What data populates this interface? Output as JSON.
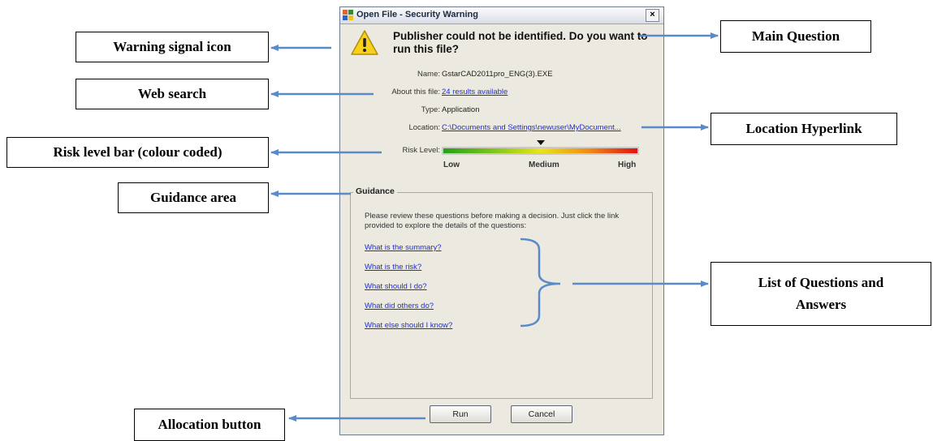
{
  "annotations": {
    "warning_icon": "Warning signal icon",
    "web_search": "Web search",
    "risk_bar": "Risk level bar (colour coded)",
    "guidance_area": "Guidance area",
    "allocation_button": "Allocation button",
    "main_question": "Main Question",
    "location_hyperlink": "Location Hyperlink",
    "qa_list_line1": "List of Questions and",
    "qa_list_line2": "Answers"
  },
  "dialog": {
    "title": "Open File - Security Warning",
    "close_glyph": "×",
    "question": "Publisher could not be identified. Do you want to run this file?",
    "fields": {
      "name_label": "Name:",
      "name_value": "GstarCAD2011pro_ENG(3).EXE",
      "about_label": "About this file:",
      "about_value": "24 results available",
      "type_label": "Type:",
      "type_value": "Application",
      "location_label": "Location:",
      "location_value": "C:\\Documents and Settings\\newuser\\MyDocument..."
    },
    "risk": {
      "label": "Risk Level:",
      "low": "Low",
      "medium": "Medium",
      "high": "High",
      "level_fraction": 0.5,
      "colors": [
        "#22a11b",
        "#e8e517",
        "#de1414"
      ]
    },
    "guidance": {
      "legend": "Guidance",
      "intro": "Please review these questions before making a decision. Just click the link provided to explore the details of the questions:",
      "questions": [
        "What is the summary?",
        "What is the risk?",
        "What should I do?",
        "What did others do?",
        "What else should I know?"
      ]
    },
    "buttons": {
      "run": "Run",
      "cancel": "Cancel"
    }
  },
  "colors": {
    "arrow": "#5b8ac8",
    "link": "#1f2fd1",
    "dialog_bg": "#ece9e0"
  }
}
